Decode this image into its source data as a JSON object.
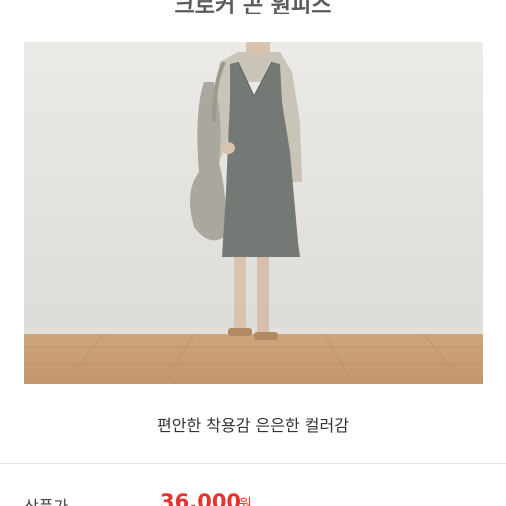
{
  "product": {
    "title": "크로커 곤 원피스",
    "caption": "편안한 착용감 은은한 컬러감",
    "price_label": "상품가",
    "price_value": "36,000",
    "price_unit": "원"
  },
  "colors": {
    "price": "#e8322e",
    "floor": "#c79a6e",
    "wall": "#e6e5e2",
    "dress": "#757975"
  }
}
